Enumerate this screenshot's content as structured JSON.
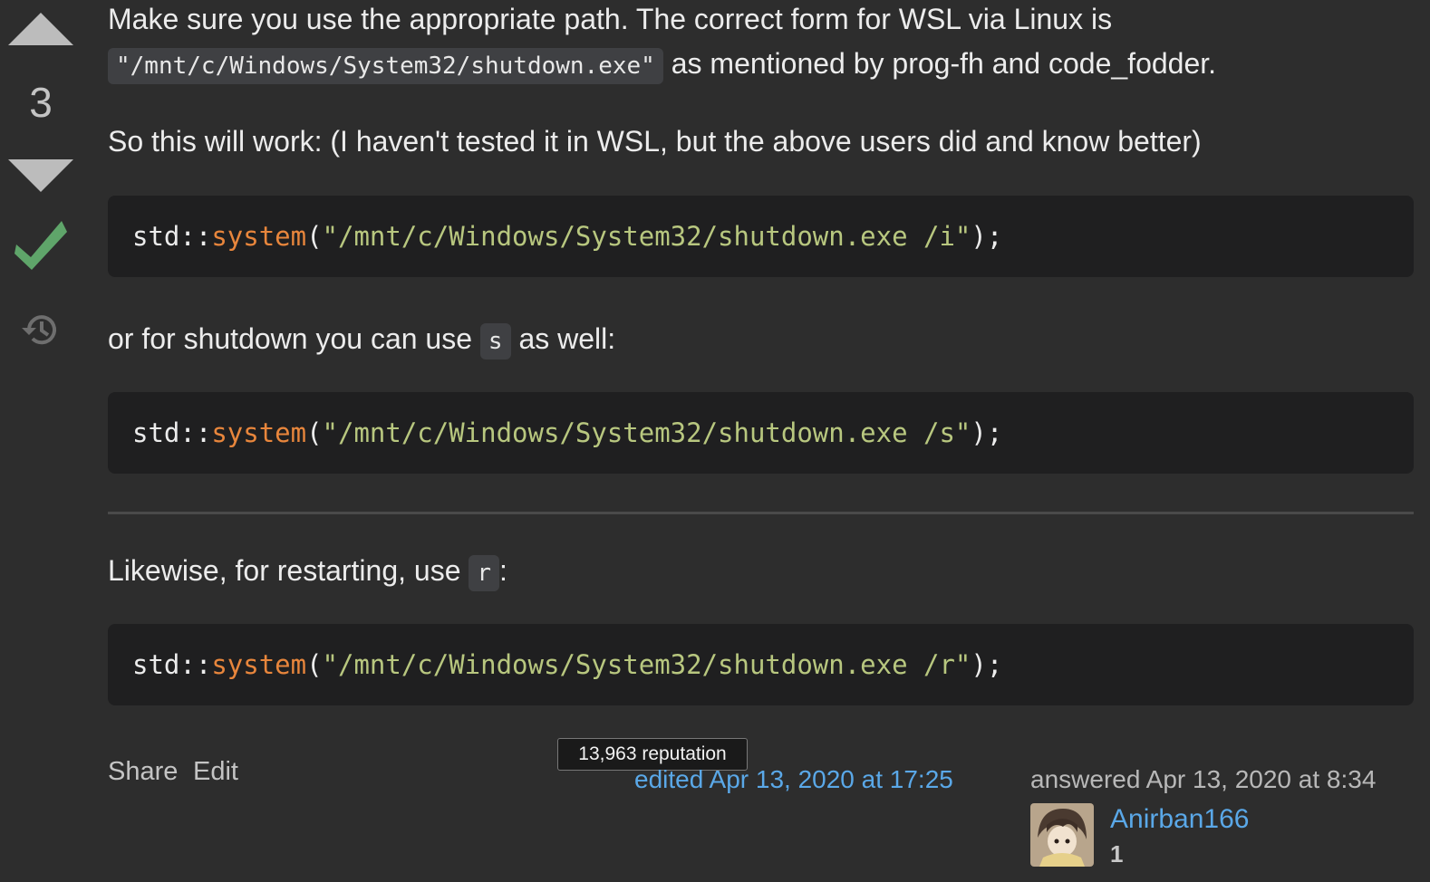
{
  "vote": {
    "count": "3"
  },
  "post": {
    "p1_text_a": "Make sure you use the appropriate path. The correct form for WSL via Linux is",
    "p1_code": "\"/mnt/c/Windows/System32/shutdown.exe\"",
    "p1_text_b": " as mentioned by prog-fh and code_fodder.",
    "p2_text": "So this will work: (I haven't tested it in WSL, but the above users did and know better)",
    "p3_text_a": "or for shutdown you can use ",
    "p3_code": "s",
    "p3_text_b": " as well:",
    "p4_text_a": "Likewise, for restarting, use ",
    "p4_code": "r",
    "p4_text_b": ":",
    "code_blocks": [
      {
        "ns": "std::",
        "fn": "system",
        "open": "(",
        "str": "\"/mnt/c/Windows/System32/shutdown.exe /i\"",
        "close": ");"
      },
      {
        "ns": "std::",
        "fn": "system",
        "open": "(",
        "str": "\"/mnt/c/Windows/System32/shutdown.exe /s\"",
        "close": ");"
      },
      {
        "ns": "std::",
        "fn": "system",
        "open": "(",
        "str": "\"/mnt/c/Windows/System32/shutdown.exe /r\"",
        "close": ");"
      }
    ]
  },
  "footer": {
    "share_label": "Share",
    "edit_label": "Edit",
    "tooltip": "13,963 reputation",
    "edited_text": "edited Apr 13, 2020 at 17:25",
    "answered_text": "answered Apr 13, 2020 at 8:34",
    "username": "Anirban166",
    "reputation": "1"
  },
  "icons": {
    "upvote": "upvote-arrow-icon",
    "downvote": "downvote-arrow-icon",
    "accepted": "accepted-checkmark-icon",
    "history": "history-clock-icon"
  },
  "colors": {
    "background": "#2d2d2d",
    "code_background": "#1f1f20",
    "link": "#5aa8e8",
    "accepted": "#5fa56a",
    "function": "#e8863c",
    "string": "#b8c77f"
  }
}
